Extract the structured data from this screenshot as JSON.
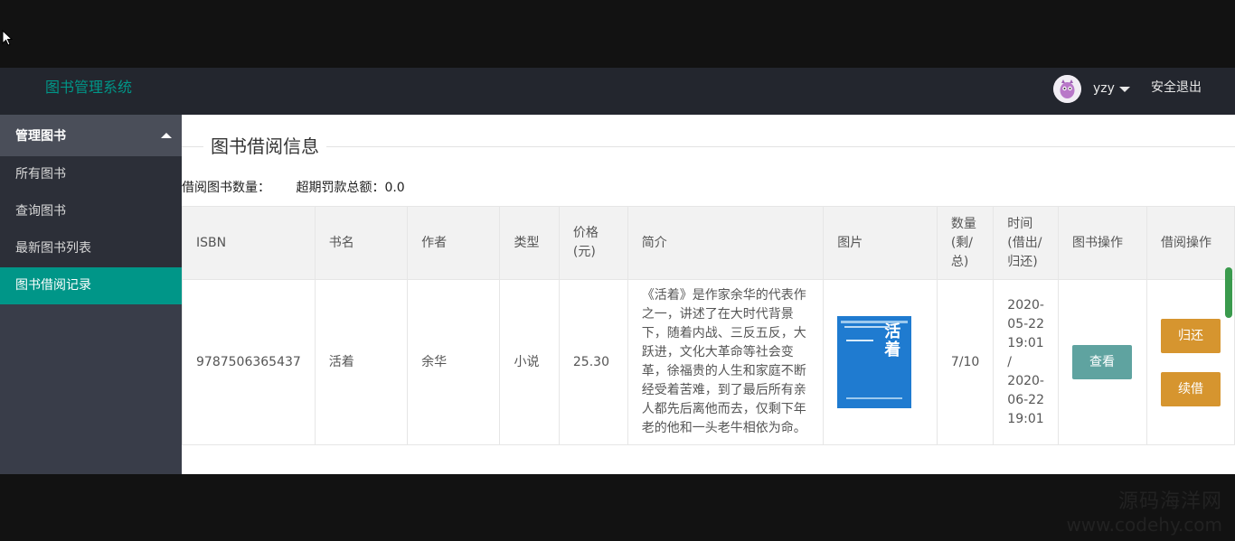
{
  "header": {
    "title": "图书管理系统",
    "username": "yzy",
    "logout": "安全退出"
  },
  "sidebar": {
    "group": "管理图书",
    "items": [
      {
        "label": "所有图书"
      },
      {
        "label": "查询图书"
      },
      {
        "label": "最新图书列表"
      },
      {
        "label": "图书借阅记录",
        "active": true
      }
    ]
  },
  "main": {
    "legend": "图书借阅信息",
    "stats": {
      "borrow_count_label": "借阅图书数量：",
      "fine_label": "超期罚款总额：",
      "fine_value": "0.0"
    },
    "columns": [
      "ISBN",
      "书名",
      "作者",
      "类型",
      "价格(元)",
      "简介",
      "图片",
      "数量(剩/总)",
      "时间(借出/归还)",
      "图书操作",
      "借阅操作"
    ],
    "rows": [
      {
        "isbn": "9787506365437",
        "title": "活着",
        "author": "余华",
        "type": "小说",
        "price": "25.30",
        "intro": "《活着》是作家余华的代表作之一，讲述了在大时代背景下，随着内战、三反五反，大跃进，文化大革命等社会变革，徐福贵的人生和家庭不断经受着苦难，到了最后所有亲人都先后离他而去，仅剩下年老的他和一头老牛相依为命。",
        "cover_text": "活着",
        "quantity": "7/10",
        "time": "2020-05-22 19:01 / 2020-06-22 19:01",
        "view_label": "查看",
        "return_label": "归还",
        "renew_label": "续借"
      }
    ]
  },
  "watermark": {
    "line1": "源码海洋网",
    "line2": "www.codehy.com"
  },
  "colors": {
    "accent": "#009688",
    "header_bg": "#23262e",
    "sidebar_bg": "#393d49",
    "warn_button": "#d6952f",
    "view_button": "#5fa3a0"
  }
}
